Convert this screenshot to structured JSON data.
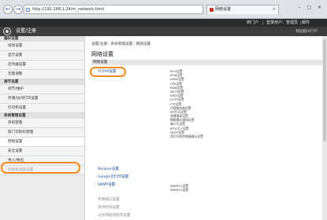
{
  "browser": {
    "url": "http://192.168.1.24/m_network.html",
    "tab_title": "网络设置",
    "back_glyph": "←",
    "forward_glyph": "→",
    "window_controls": "– ▢ ✕",
    "tab_close": "×"
  },
  "topbar": {
    "portal_label": "到门户",
    "login_user": "登录用户：",
    "admin": "管理员",
    "device_name_label": "设备名称：",
    "device_name": "784321",
    "mail_label": "邮件"
  },
  "header": {
    "title": "设置/注册",
    "portal_link": "到远程UI门户"
  },
  "sidebar": {
    "groups": [
      {
        "title": "偏好设置",
        "items": [
          "纸张设置",
          "显示设置",
          "定时器设置",
          "音量调整"
        ]
      },
      {
        "title": "调节设置",
        "items": [
          "调节/维护",
          "存储/访问打印设置",
          "打印机设置"
        ]
      },
      {
        "title": "系统管理设置",
        "items": [
          "系统管理",
          "部门识别码管理",
          "网络设置",
          "安全设置",
          "导入/导出",
          "初始化设备设置"
        ]
      }
    ]
  },
  "main": {
    "breadcrumb": "设置/注册：系统管理设置：网络设置",
    "page_title": "网络设置",
    "section_title": "网络设置",
    "links": {
      "tcpip": "TCP/IP设置",
      "bonjour": "Bonjour设置",
      "google": "Google云打印设置",
      "snmp": "SNMP设置",
      "dedicated": "专用端口设置",
      "waiting": "等待时间设置",
      "ethernet": "以太网驱动程序设置"
    },
    "tcpip_subitems": [
      "IPv4设置",
      "IPv6设置",
      "WINS设置",
      "LPD设置",
      "RAW设置",
      "SNTP设置",
      "WSD设置",
      "HTTP设置",
      "FTP设置",
      "代理服务器设置",
      "IPP打印设置",
      "多播搜索设置",
      "睡眠模式通知设置",
      "端口号设置",
      "MTU大小设置",
      "SMTP设置",
      "用打印机控制器确认设置"
    ],
    "snmp_subitems": [
      "SNMPv1设置",
      "SNMPv3设置"
    ]
  }
}
